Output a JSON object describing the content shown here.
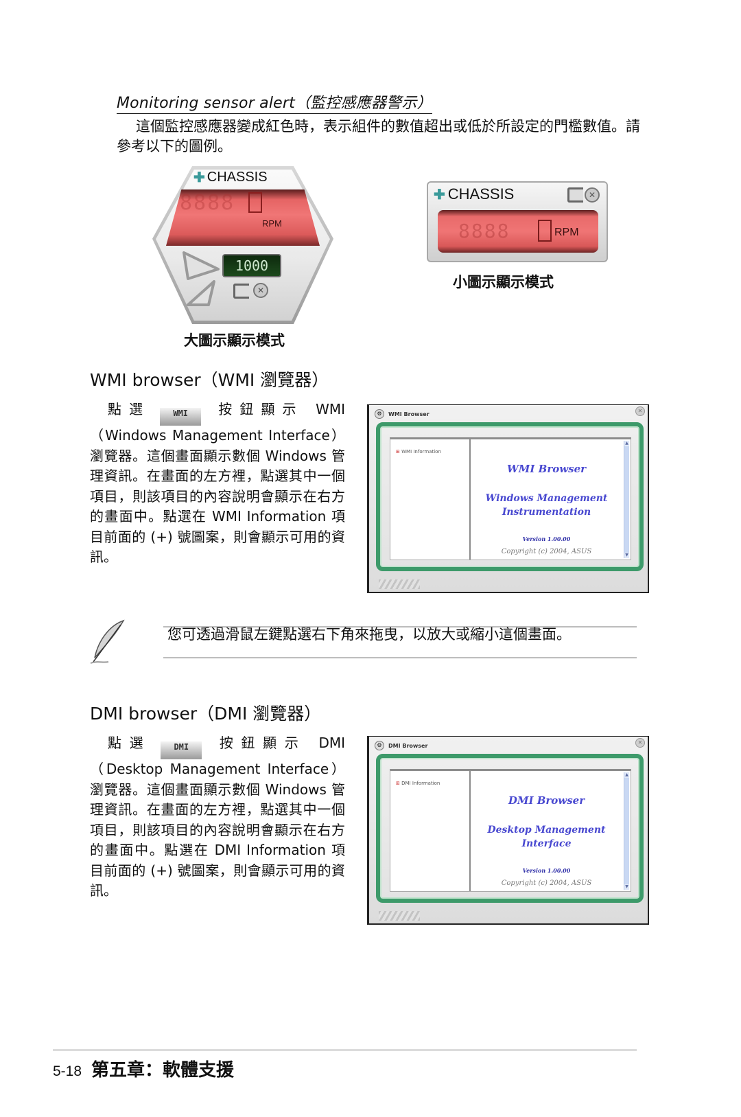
{
  "monitoring": {
    "title": "Monitoring sensor alert（監控感應器警示）",
    "paragraph": "這個監控感應器變成紅色時，表示組件的數值超出或低於所設定的門檻數值。請參考以下的圖例。",
    "large_widget": {
      "label": "CHASSIS",
      "fan_icon": "fan-icon",
      "unit": "RPM",
      "reading_digits": "8888",
      "threshold": "1000",
      "caption": "大圖示顯示模式",
      "status_color": "#e86a6a"
    },
    "small_widget": {
      "label": "CHASSIS",
      "fan_icon": "fan-icon",
      "unit": "RPM",
      "reading_digits": "8888",
      "caption": "小圖示顯示模式",
      "status_color": "#e86a6a"
    }
  },
  "wmi": {
    "title": "WMI browser（WMI 瀏覽器）",
    "intro_pre": "點選",
    "button_label": "WMI",
    "intro_post": "按鈕顯示 WMI（Windows Management Interface）瀏覽器。這個畫面顯示數個 Windows 管理資訊。在畫面的左方裡，點選其中一個項目，則該項目的內容說明會顯示在右方的畫面中。點選在 WMI Information 項目前面的 (+) 號圖案，則會顯示可用的資訊。",
    "window": {
      "title": "WMI Browser",
      "tree_item": "WMI Information",
      "heading": "WMI Browser",
      "subheading_line1": "Windows Management",
      "subheading_line2": "Instrumentation",
      "version": "Version 1.00.00",
      "copyright": "Copyright (c) 2004,  ASUS"
    }
  },
  "note": {
    "icon": "feather-pen-icon",
    "text": "您可透過滑鼠左鍵點選右下角來拖曳，以放大或縮小這個畫面。"
  },
  "dmi": {
    "title": "DMI browser（DMI 瀏覽器）",
    "intro_pre": "點選",
    "button_label": "DMI",
    "intro_post": "按鈕顯示 DMI（Desktop Management Interface）瀏覽器。這個畫面顯示數個 Windows 管理資訊。在畫面的左方裡，點選其中一個項目，則該項目的內容說明會顯示在右方的畫面中。點選在 DMI Information 項目前面的 (+) 號圖案，則會顯示可用的資訊。",
    "window": {
      "title": "DMI Browser",
      "tree_item": "DMI Information",
      "heading": "DMI Browser",
      "subheading_line1": "Desktop Management",
      "subheading_line2": "Interface",
      "version": "Version 1.00.00",
      "copyright": "Copyright (c) 2004,  ASUS"
    }
  },
  "footer": {
    "page_number": "5-18",
    "chapter": "第五章：軟體支援"
  }
}
